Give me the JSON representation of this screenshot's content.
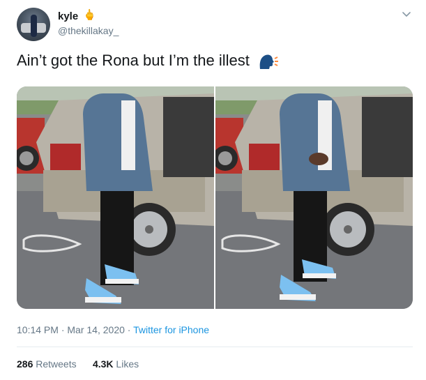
{
  "user": {
    "display_name": "kyle",
    "name_emoji": "🖕",
    "handle": "@thekillakay_"
  },
  "tweet": {
    "text": "Ain’t got the Rona but I’m the illest"
  },
  "media": [
    {
      "alt": "Person in denim jacket and blue sneakers standing beside a silver SUV"
    },
    {
      "alt": "Same person by the silver SUV, hand gesture"
    }
  ],
  "meta": {
    "time": "10:14 PM",
    "date": "Mar 14, 2020",
    "sep": "·",
    "source": "Twitter for iPhone"
  },
  "stats": {
    "retweets_count": "286",
    "retweets_label": "Retweets",
    "likes_count": "4.3K",
    "likes_label": "Likes"
  },
  "colors": {
    "link": "#1b95e0",
    "muted": "#657786",
    "divider": "#e6ecf0"
  }
}
